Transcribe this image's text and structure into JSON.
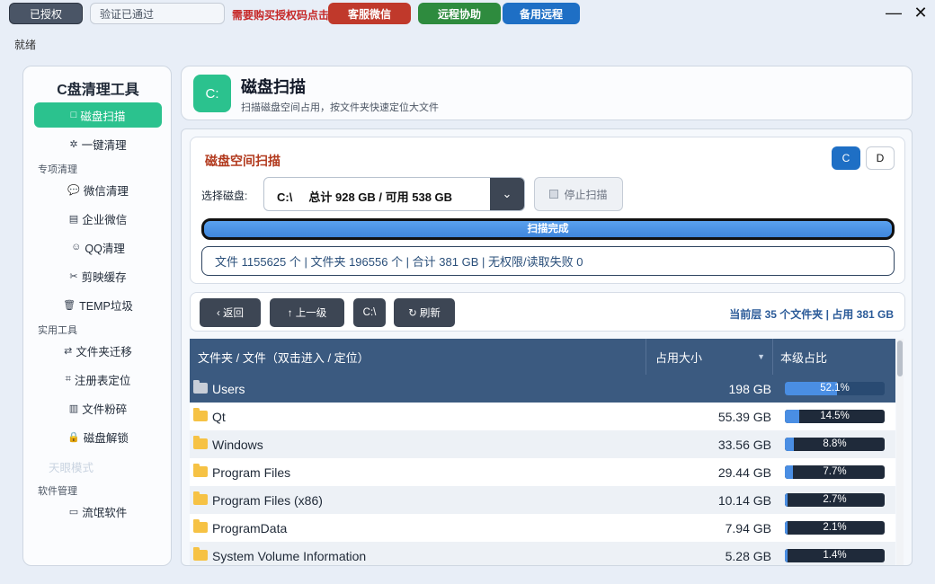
{
  "topbar": {
    "license_label": "已授权",
    "verify_text": "验证已通过",
    "buy_link": "需要购买授权码点击",
    "btn_wechat": "客服微信",
    "btn_remote": "远程协助",
    "btn_backup": "备用远程",
    "minimize": "—",
    "close": "✕"
  },
  "status_text": "就绪",
  "sidebar": {
    "title": "C盘清理工具",
    "items": [
      {
        "icon": "□",
        "label": "磁盘扫描"
      },
      {
        "icon": "✲",
        "label": "一键清理"
      },
      {
        "icon": "💬",
        "label": "微信清理"
      },
      {
        "icon": "▤",
        "label": "企业微信"
      },
      {
        "icon": "☺",
        "label": "QQ清理"
      },
      {
        "icon": "✂",
        "label": "剪映缓存"
      },
      {
        "icon": "🗑",
        "label": "TEMP垃圾"
      },
      {
        "icon": "⇄",
        "label": "文件夹迁移"
      },
      {
        "icon": "⌗",
        "label": "注册表定位"
      },
      {
        "icon": "▥",
        "label": "文件粉碎"
      },
      {
        "icon": "🔒",
        "label": "磁盘解锁"
      },
      {
        "icon": "▭",
        "label": "流氓软件"
      }
    ],
    "groups": [
      "专项清理",
      "实用工具",
      "软件管理"
    ],
    "faded_item": "天眼模式"
  },
  "header": {
    "badge": "C:",
    "title": "磁盘扫描",
    "subtitle": "扫描磁盘空间占用，按文件夹快速定位大文件"
  },
  "scan": {
    "title": "磁盘空间扫描",
    "drive_c": "C",
    "drive_d": "D",
    "select_label": "选择磁盘:",
    "select_value": "C:\\     总计 928 GB / 可用 538 GB",
    "select_arrow": "⌄",
    "stop_label": "停止扫描",
    "progress_value": 1.0,
    "progress_text": "扫描完成",
    "stats": "文件 1155625 个 | 文件夹 196556 个 | 合计 381 GB | 无权限/读取失败 0"
  },
  "nav": {
    "back": "‹ 返回",
    "up": "↑ 上一级",
    "root": "C:\\",
    "refresh": "↻ 刷新",
    "info": "当前层 35 个文件夹 | 占用 381 GB"
  },
  "table": {
    "col_name": "文件夹 / 文件（双击进入 / 定位）",
    "col_size": "占用大小",
    "col_pct": "本级占比",
    "sort_icon": "▼",
    "rows": [
      {
        "name": "Users",
        "size": "198 GB",
        "pct": 52.1,
        "pct_text": "52.1%"
      },
      {
        "name": "Qt",
        "size": "55.39 GB",
        "pct": 14.5,
        "pct_text": "14.5%"
      },
      {
        "name": "Windows",
        "size": "33.56 GB",
        "pct": 8.8,
        "pct_text": "8.8%"
      },
      {
        "name": "Program Files",
        "size": "29.44 GB",
        "pct": 7.7,
        "pct_text": "7.7%"
      },
      {
        "name": "Program Files (x86)",
        "size": "10.14 GB",
        "pct": 2.7,
        "pct_text": "2.7%"
      },
      {
        "name": "ProgramData",
        "size": "7.94 GB",
        "pct": 2.1,
        "pct_text": "2.1%"
      },
      {
        "name": "System Volume Information",
        "size": "5.28 GB",
        "pct": 1.4,
        "pct_text": "1.4%"
      }
    ]
  },
  "colors": {
    "accent_green": "#2bc28e",
    "accent_blue": "#1e6fc5",
    "header_row": "#3b5a80",
    "danger": "#c0392b"
  }
}
